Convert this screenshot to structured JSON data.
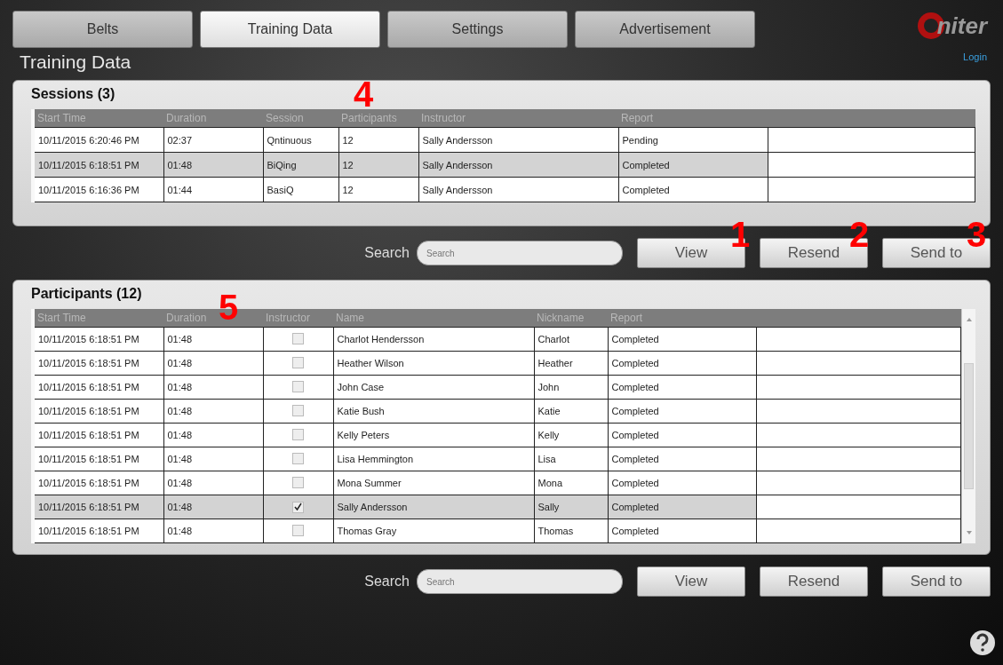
{
  "tabs": [
    {
      "label": "Belts",
      "selected": false
    },
    {
      "label": "Training Data",
      "selected": true
    },
    {
      "label": "Settings",
      "selected": false
    },
    {
      "label": "Advertisement",
      "selected": false
    }
  ],
  "logo": {
    "text": "niter"
  },
  "login": "Login",
  "page_title": "Training Data",
  "sessions": {
    "title": "Sessions (3)",
    "columns": [
      "Start Time",
      "Duration",
      "Session",
      "Participants",
      "Instructor",
      "Report"
    ],
    "rows": [
      {
        "selected": false,
        "cells": [
          "10/11/2015 6:20:46 PM",
          "02:37",
          "Qntinuous",
          "12",
          "Sally Andersson",
          "Pending"
        ]
      },
      {
        "selected": true,
        "cells": [
          "10/11/2015 6:18:51 PM",
          "01:48",
          "BiQing",
          "12",
          "Sally Andersson",
          "Completed"
        ]
      },
      {
        "selected": false,
        "cells": [
          "10/11/2015 6:16:36 PM",
          "01:44",
          "BasiQ",
          "12",
          "Sally Andersson",
          "Completed"
        ]
      }
    ],
    "search": {
      "label": "Search",
      "placeholder": "Search"
    },
    "buttons": [
      "View",
      "Resend",
      "Send to"
    ]
  },
  "participants": {
    "title": "Participants (12)",
    "columns": [
      "Start Time",
      "Duration",
      "Instructor",
      "Name",
      "Nickname",
      "Report"
    ],
    "rows": [
      {
        "selected": false,
        "instructor": false,
        "start": "10/11/2015 6:18:51 PM",
        "duration": "01:48",
        "name": "Charlot Hendersson",
        "nickname": "Charlot",
        "report": "Completed"
      },
      {
        "selected": false,
        "instructor": false,
        "start": "10/11/2015 6:18:51 PM",
        "duration": "01:48",
        "name": "Heather Wilson",
        "nickname": "Heather",
        "report": "Completed"
      },
      {
        "selected": false,
        "instructor": false,
        "start": "10/11/2015 6:18:51 PM",
        "duration": "01:48",
        "name": "John Case",
        "nickname": "John",
        "report": "Completed"
      },
      {
        "selected": false,
        "instructor": false,
        "start": "10/11/2015 6:18:51 PM",
        "duration": "01:48",
        "name": "Katie Bush",
        "nickname": "Katie",
        "report": "Completed"
      },
      {
        "selected": false,
        "instructor": false,
        "start": "10/11/2015 6:18:51 PM",
        "duration": "01:48",
        "name": "Kelly Peters",
        "nickname": "Kelly",
        "report": "Completed"
      },
      {
        "selected": false,
        "instructor": false,
        "start": "10/11/2015 6:18:51 PM",
        "duration": "01:48",
        "name": "Lisa Hemmington",
        "nickname": "Lisa",
        "report": "Completed"
      },
      {
        "selected": false,
        "instructor": false,
        "start": "10/11/2015 6:18:51 PM",
        "duration": "01:48",
        "name": "Mona Summer",
        "nickname": "Mona",
        "report": "Completed"
      },
      {
        "selected": true,
        "instructor": true,
        "start": "10/11/2015 6:18:51 PM",
        "duration": "01:48",
        "name": "Sally Andersson",
        "nickname": "Sally",
        "report": "Completed"
      },
      {
        "selected": false,
        "instructor": false,
        "start": "10/11/2015 6:18:51 PM",
        "duration": "01:48",
        "name": "Thomas Gray",
        "nickname": "Thomas",
        "report": "Completed"
      }
    ],
    "search": {
      "label": "Search",
      "placeholder": "Search"
    },
    "buttons": [
      "View",
      "Resend",
      "Send to"
    ]
  },
  "callouts": [
    "4",
    "1",
    "2",
    "3",
    "5"
  ]
}
